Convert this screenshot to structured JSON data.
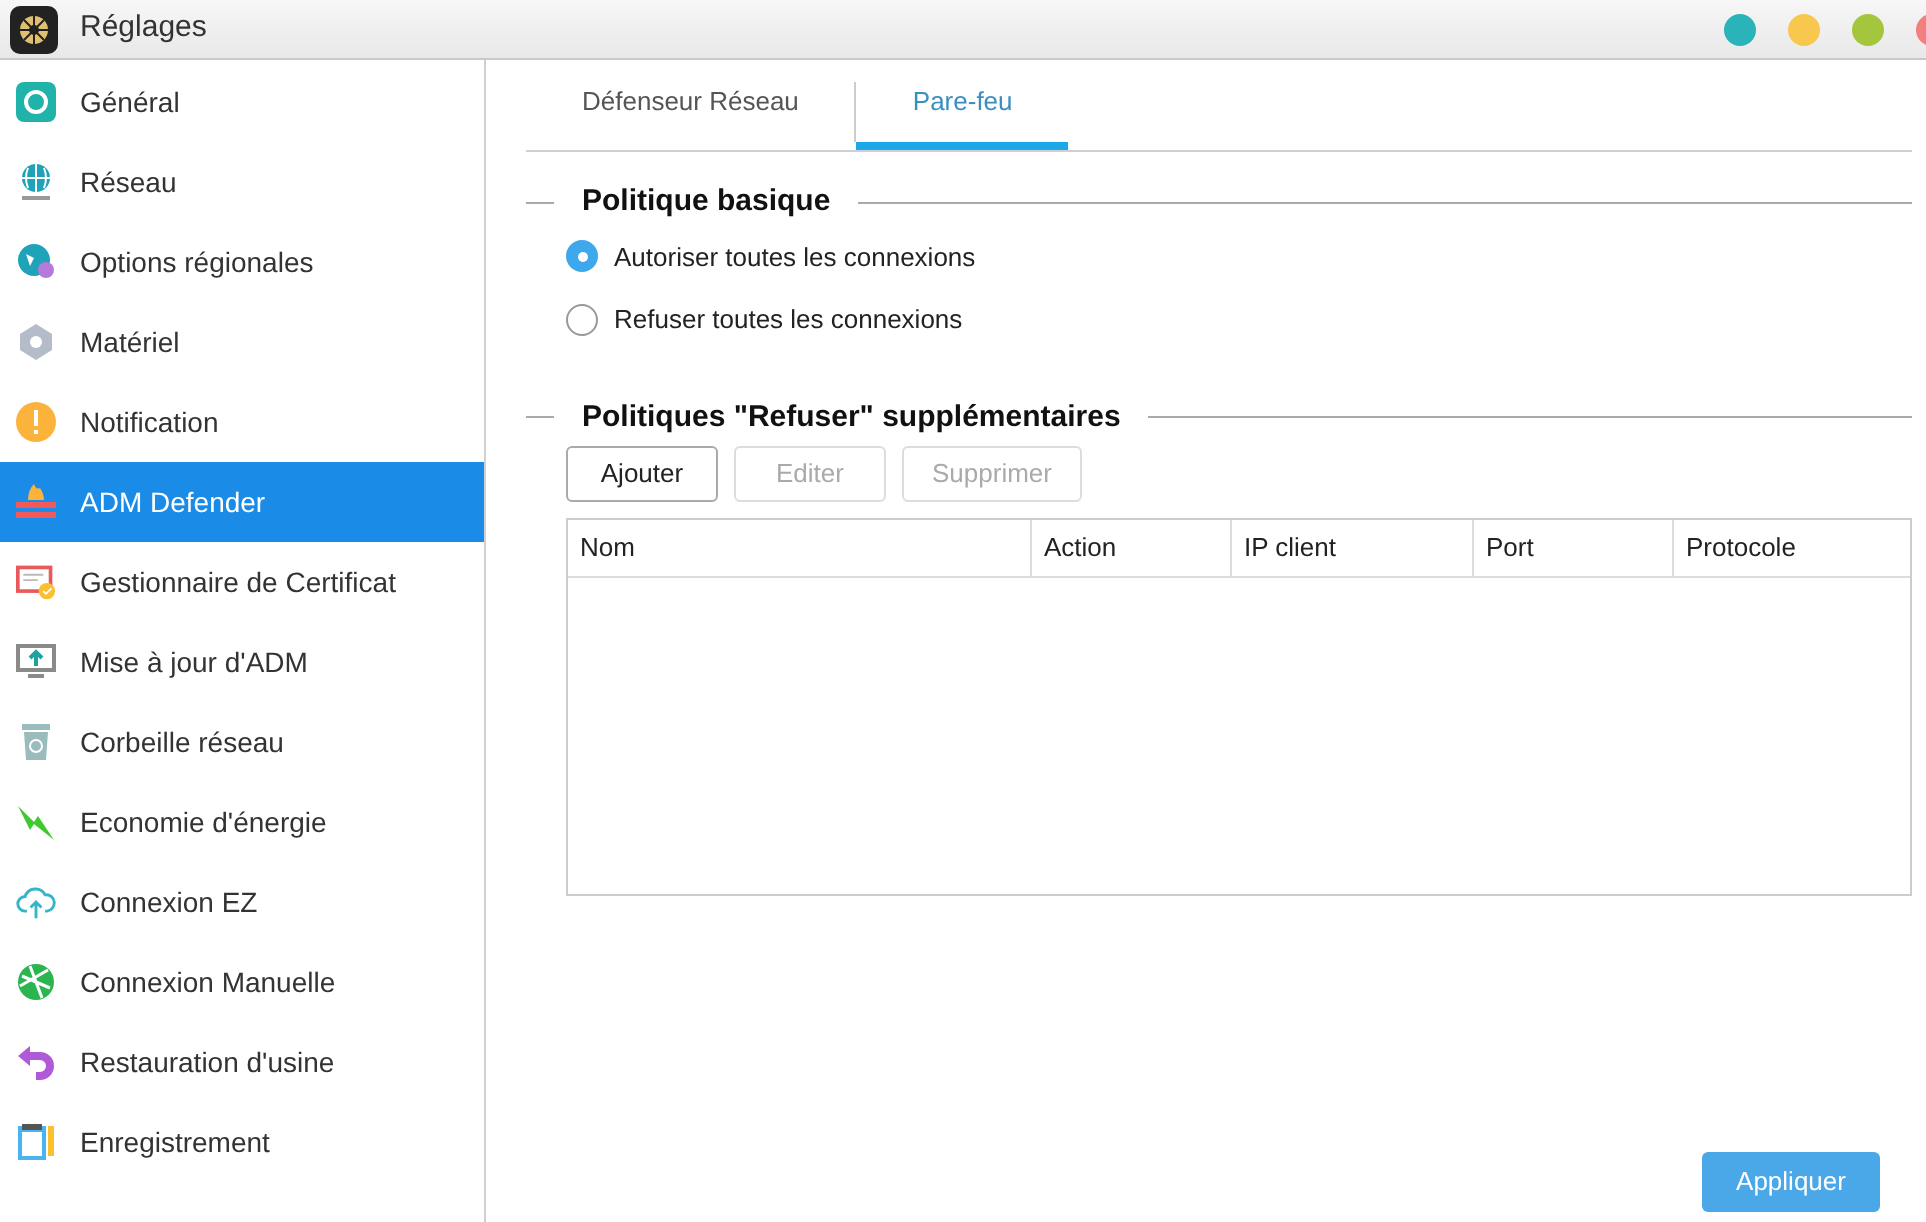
{
  "window": {
    "title": "Réglages",
    "controls": [
      {
        "color": "#2ab3b8"
      },
      {
        "color": "#f8c74e"
      },
      {
        "color": "#a3c63d"
      },
      {
        "color": "#f47f7f"
      }
    ]
  },
  "sidebar": {
    "items": [
      {
        "label": "Général",
        "selected": false
      },
      {
        "label": "Réseau",
        "selected": false
      },
      {
        "label": "Options régionales",
        "selected": false
      },
      {
        "label": "Matériel",
        "selected": false
      },
      {
        "label": "Notification",
        "selected": false
      },
      {
        "label": "ADM Defender",
        "selected": true
      },
      {
        "label": "Gestionnaire de Certificat",
        "selected": false
      },
      {
        "label": "Mise à jour d'ADM",
        "selected": false
      },
      {
        "label": "Corbeille réseau",
        "selected": false
      },
      {
        "label": "Economie d'énergie",
        "selected": false
      },
      {
        "label": "Connexion EZ",
        "selected": false
      },
      {
        "label": "Connexion Manuelle",
        "selected": false
      },
      {
        "label": "Restauration d'usine",
        "selected": false
      },
      {
        "label": "Enregistrement",
        "selected": false
      }
    ]
  },
  "tabs": [
    {
      "label": "Défenseur Réseau",
      "selected": false
    },
    {
      "label": "Pare-feu",
      "selected": true
    }
  ],
  "basic_policy": {
    "title": "Politique basique",
    "options": [
      {
        "label": "Autoriser toutes les connexions",
        "selected": true
      },
      {
        "label": "Refuser toutes les connexions",
        "selected": false
      }
    ]
  },
  "deny_policies": {
    "title": "Politiques \"Refuser\" supplémentaires",
    "buttons": [
      {
        "label": "Ajouter",
        "disabled": false
      },
      {
        "label": "Editer",
        "disabled": true
      },
      {
        "label": "Supprimer",
        "disabled": true
      }
    ],
    "table": {
      "columns": [
        "Nom",
        "Action",
        "IP client",
        "Port",
        "Protocole"
      ]
    }
  },
  "apply_button": "Appliquer"
}
